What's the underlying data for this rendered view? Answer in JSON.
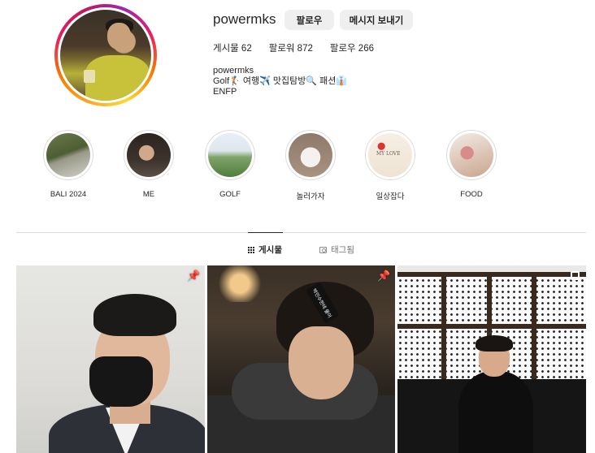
{
  "profile": {
    "username": "powermks",
    "follow_label": "팔로우",
    "message_label": "메시지 보내기",
    "stats": {
      "posts": "게시물 62",
      "followers": "팔로워 872",
      "following": "팔로우 266"
    },
    "bio": {
      "name": "powermks",
      "line1": "Golf🏌 여행✈️ 맛집탐방🔍 패션👔",
      "line2": "ENFP"
    }
  },
  "highlights": [
    {
      "label": "BALI 2024"
    },
    {
      "label": "ME"
    },
    {
      "label": "GOLF"
    },
    {
      "label": "놀러가자"
    },
    {
      "label": "일상잡다",
      "art_text": "MY LOVE"
    },
    {
      "label": "FOOD"
    }
  ],
  "tabs": {
    "posts_label": "게시물",
    "tagged_label": "태그됨"
  },
  "posts": [
    {
      "badge": "pin-icon"
    },
    {
      "badge": "pin-icon",
      "sticker_text": "박민수한테 물어"
    },
    {
      "badge": "carousel-icon"
    }
  ],
  "colors": {
    "button_bg": "#efefef",
    "text": "#262626",
    "muted": "#737373",
    "divider": "#dbdbdb"
  }
}
